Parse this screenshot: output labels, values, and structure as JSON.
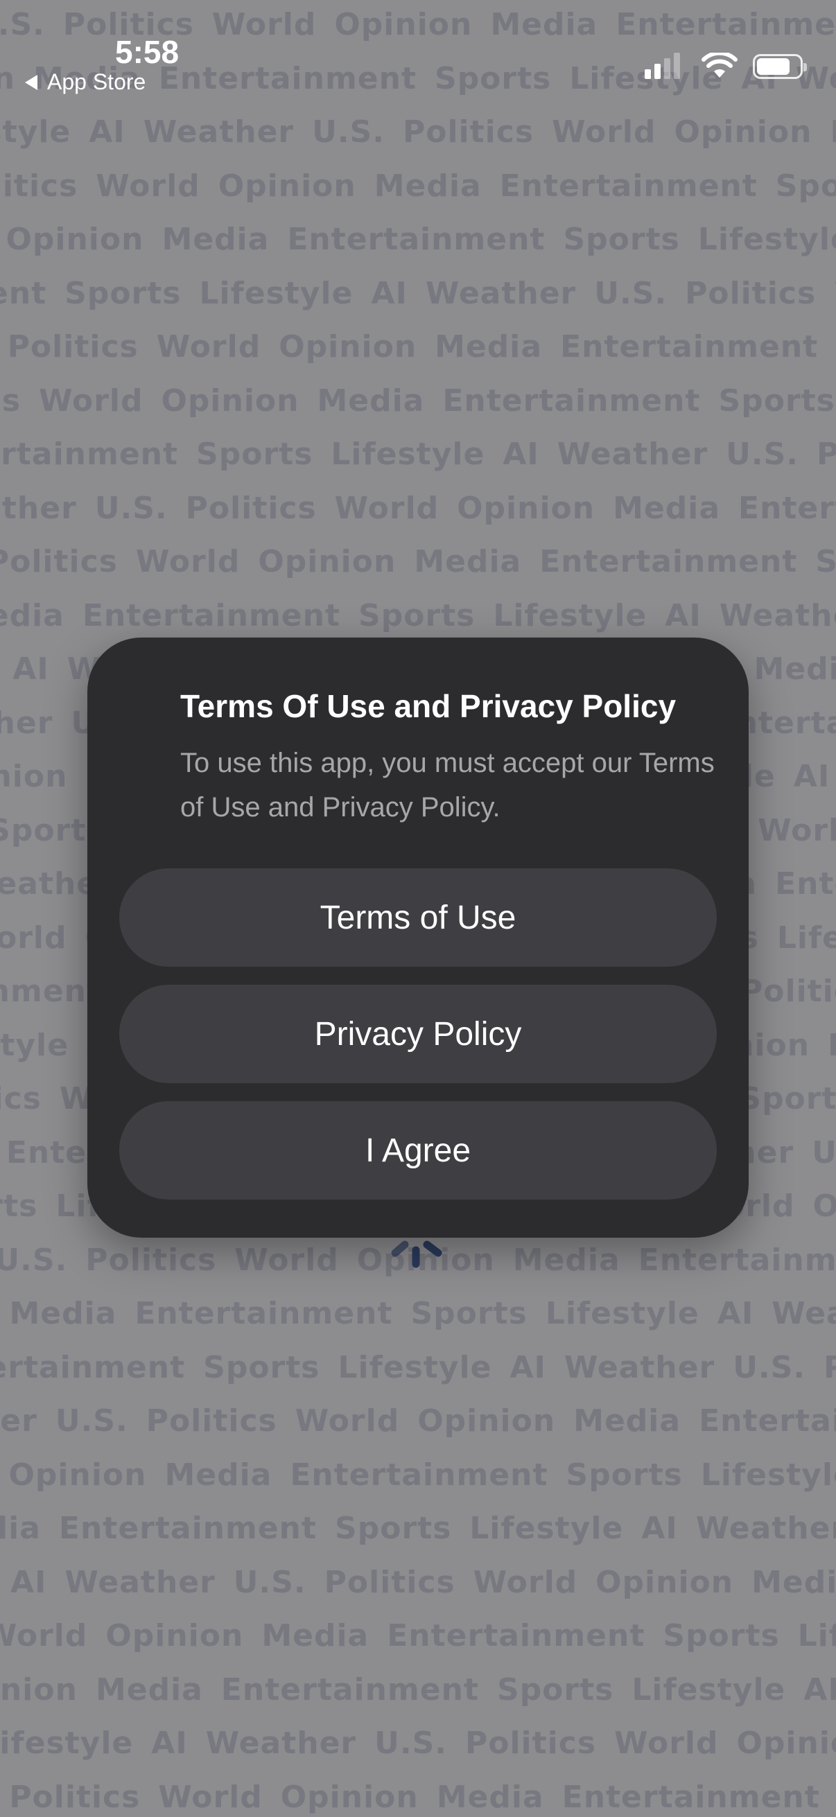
{
  "status_bar": {
    "time": "5:58",
    "back_label": "App Store",
    "icons": [
      "back-arrow-icon",
      "cellular-signal-icon",
      "wifi-icon",
      "battery-icon"
    ]
  },
  "background_pattern": {
    "words": [
      "U.S.",
      "Politics",
      "World",
      "Opinion",
      "Media",
      "Entertainment",
      "Sports",
      "Lifestyle",
      "AI",
      "Weather"
    ]
  },
  "dialog": {
    "title": "Terms Of Use and Privacy Policy",
    "message": "To use this app, you must accept our Terms of Use and Privacy Policy.",
    "buttons": [
      {
        "label": "Terms of Use"
      },
      {
        "label": "Privacy Policy"
      },
      {
        "label": "I Agree"
      }
    ]
  },
  "colors": {
    "backdrop": "#8d8d90",
    "pattern_text": "#787880",
    "dialog_background": "#2c2c2e",
    "button_background": "#3f3f43",
    "spinner": "#2b3a5c"
  }
}
